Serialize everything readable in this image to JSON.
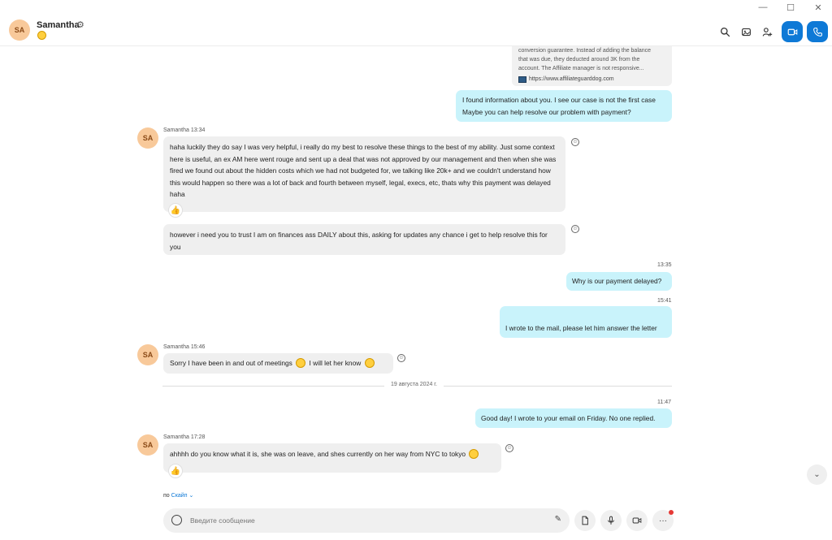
{
  "window": {
    "minimize": "—",
    "maximize": "☐",
    "close": "✕"
  },
  "header": {
    "avatar_initials": "SA",
    "contact_name": "Samantha",
    "icons": [
      "search-icon",
      "gallery-icon",
      "add-person-icon",
      "video-call-icon",
      "audio-call-icon"
    ]
  },
  "quoted": {
    "lines": [
      "conversion guarantee. Instead of adding the balance",
      "that was due, they deducted around 3K from the",
      "account. The Affiliate manager is not responsive..."
    ],
    "link": "https://www.affiliateguarddog.com"
  },
  "messages": {
    "m1": {
      "line1": "I found information about you. I see our case is not the first case",
      "line2": "Maybe you can help resolve our problem with payment?"
    },
    "m2": {
      "meta": "Samantha 13:34",
      "text": "haha luckily they do say I was very helpful, i really do my best to resolve these things to the best of my ability. Just some context here is useful, an ex AM here went rouge and sent up a deal that was not approved by our management and then when she was fired we found out about the hidden costs which we had not budgeted for, we talking like 20k+ and we couldn't understand how this would happen so there was a lot of back and fourth between myself, legal, execs, etc, thats why this payment was delayed haha"
    },
    "m3": {
      "text": "however i need you to trust I am on finances ass DAILY about this, asking for updates any chance i get to help resolve this for you"
    },
    "m4": {
      "time": "13:35",
      "text": "Why is our payment delayed?"
    },
    "m5": {
      "time": "15:41",
      "text": "I wrote to the mail, please let him answer the letter"
    },
    "m6": {
      "meta": "Samantha 15:46",
      "text_a": "Sorry I have been in and out of meetings",
      "text_b": "I will let her know"
    },
    "date_divider": "19 августа 2024 г.",
    "m7": {
      "time": "11:47",
      "text": "Good day! I wrote to your email on Friday. No one replied."
    },
    "m8": {
      "meta": "Samantha 17:28",
      "text": "ahhhh do you know what it is, she was on leave, and shes currently on her way from NYC to tokyo"
    }
  },
  "avatar_initials": "SA",
  "via": {
    "prefix": "по",
    "service": "Скайп"
  },
  "composer": {
    "placeholder": "Введите сообщение"
  }
}
